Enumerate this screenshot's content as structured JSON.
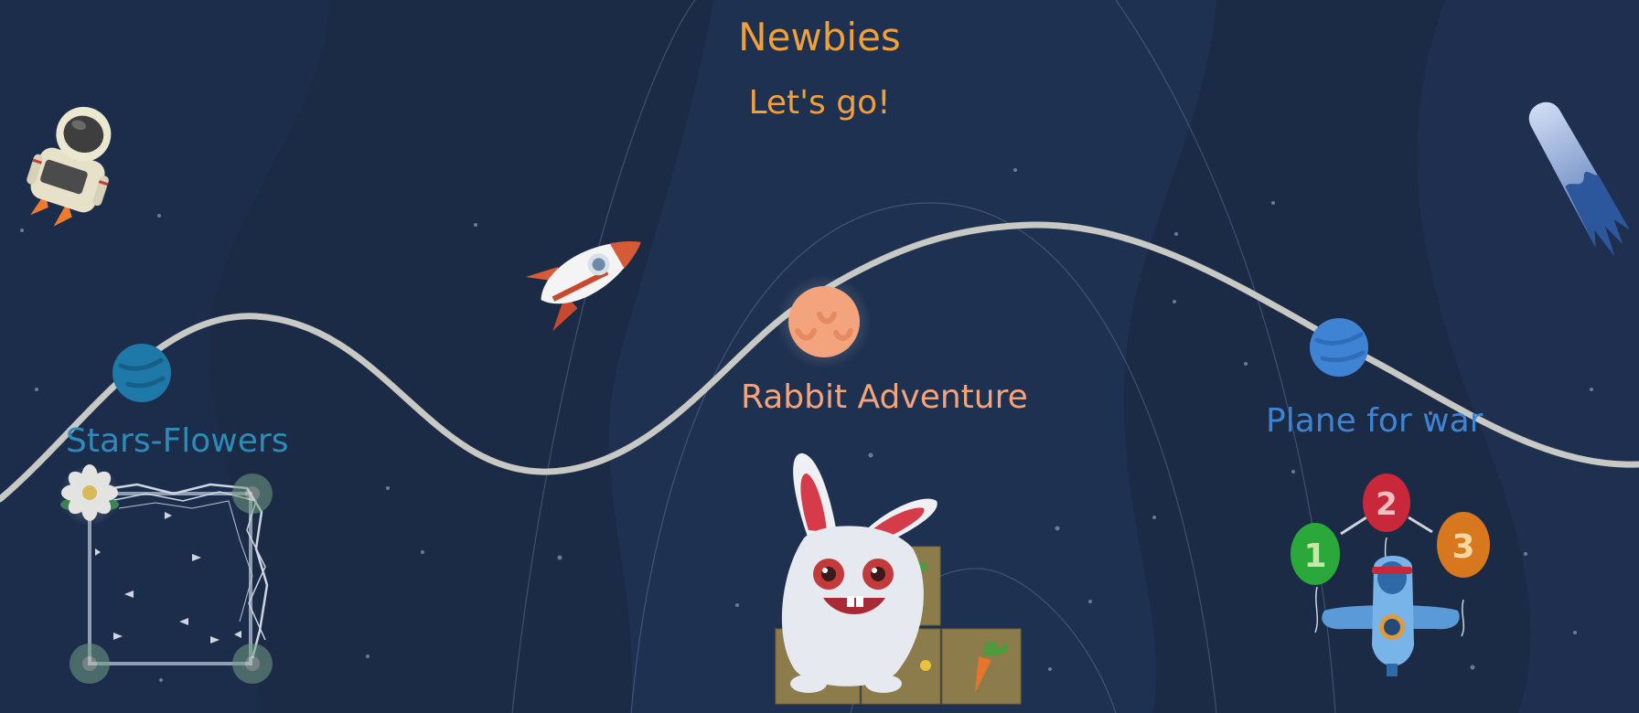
{
  "header": {
    "title": "Newbies",
    "subtitle": "Let's go!"
  },
  "levels": [
    {
      "name": "Stars-Flowers",
      "color": "#1e78a8",
      "planet": "teal-planet-icon"
    },
    {
      "name": "Rabbit Adventure",
      "color": "#f3a47c",
      "planet": "peach-planet-icon"
    },
    {
      "name": "Plane for war",
      "color": "#3f84d4",
      "planet": "blue-planet-icon"
    }
  ],
  "balloons": [
    "1",
    "2",
    "3"
  ],
  "colors": {
    "background": "#1b2a45",
    "path": "#c8c8c4",
    "title": "#f0a03a"
  }
}
